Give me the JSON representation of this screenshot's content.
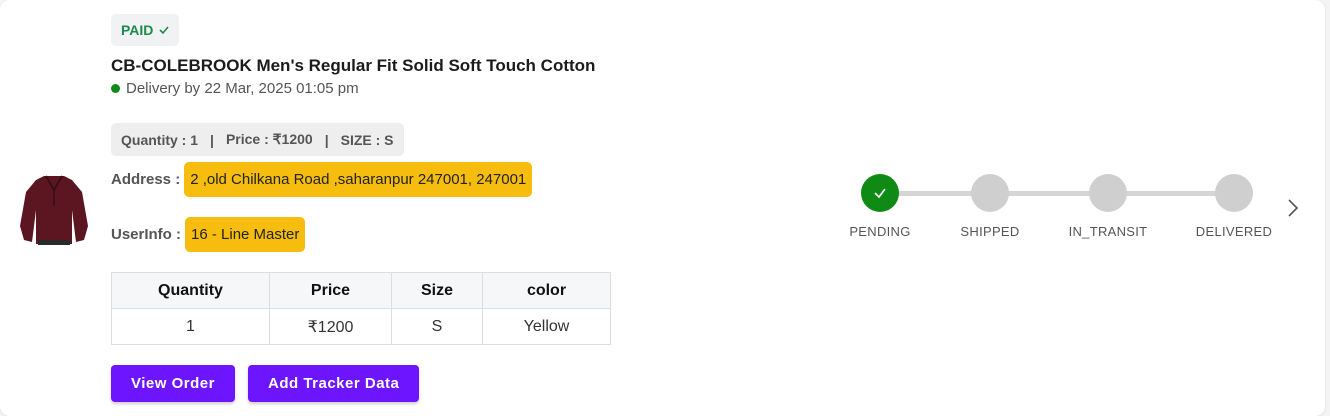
{
  "order": {
    "status_badge": "PAID",
    "title": "CB-COLEBROOK Men's Regular Fit Solid Soft Touch Cotton",
    "delivery": "Delivery by 22 Mar, 2025 01:05 pm",
    "summary": {
      "quantity": "Quantity : 1",
      "sep1": "|",
      "price": "Price : ₹1200",
      "sep2": "|",
      "size": "SIZE : S"
    },
    "address_label": "Address :",
    "address_value": "2 ,old Chilkana Road ,saharanpur 247001, 247001",
    "userinfo_label": "UserInfo :",
    "userinfo_value": "16 - Line Master"
  },
  "table": {
    "headers": [
      "Quantity",
      "Price",
      "Size",
      "color"
    ],
    "row": [
      "1",
      "₹1200",
      "S",
      "Yellow"
    ]
  },
  "buttons": {
    "view_order": "View Order",
    "add_tracker": "Add Tracker Data"
  },
  "tracker": {
    "steps": [
      {
        "label": "PENDING",
        "done": true
      },
      {
        "label": "SHIPPED",
        "done": false
      },
      {
        "label": "IN_TRANSIT",
        "done": false
      },
      {
        "label": "DELIVERED",
        "done": false
      }
    ]
  },
  "colors": {
    "accent": "#6e15ff",
    "paid": "#1f8a4d",
    "highlight": "#f6bd0f",
    "done": "#0f8a15"
  },
  "icons": {
    "paid_check": "check-icon",
    "product": "sweater-image",
    "next": "chevron-right-icon"
  }
}
